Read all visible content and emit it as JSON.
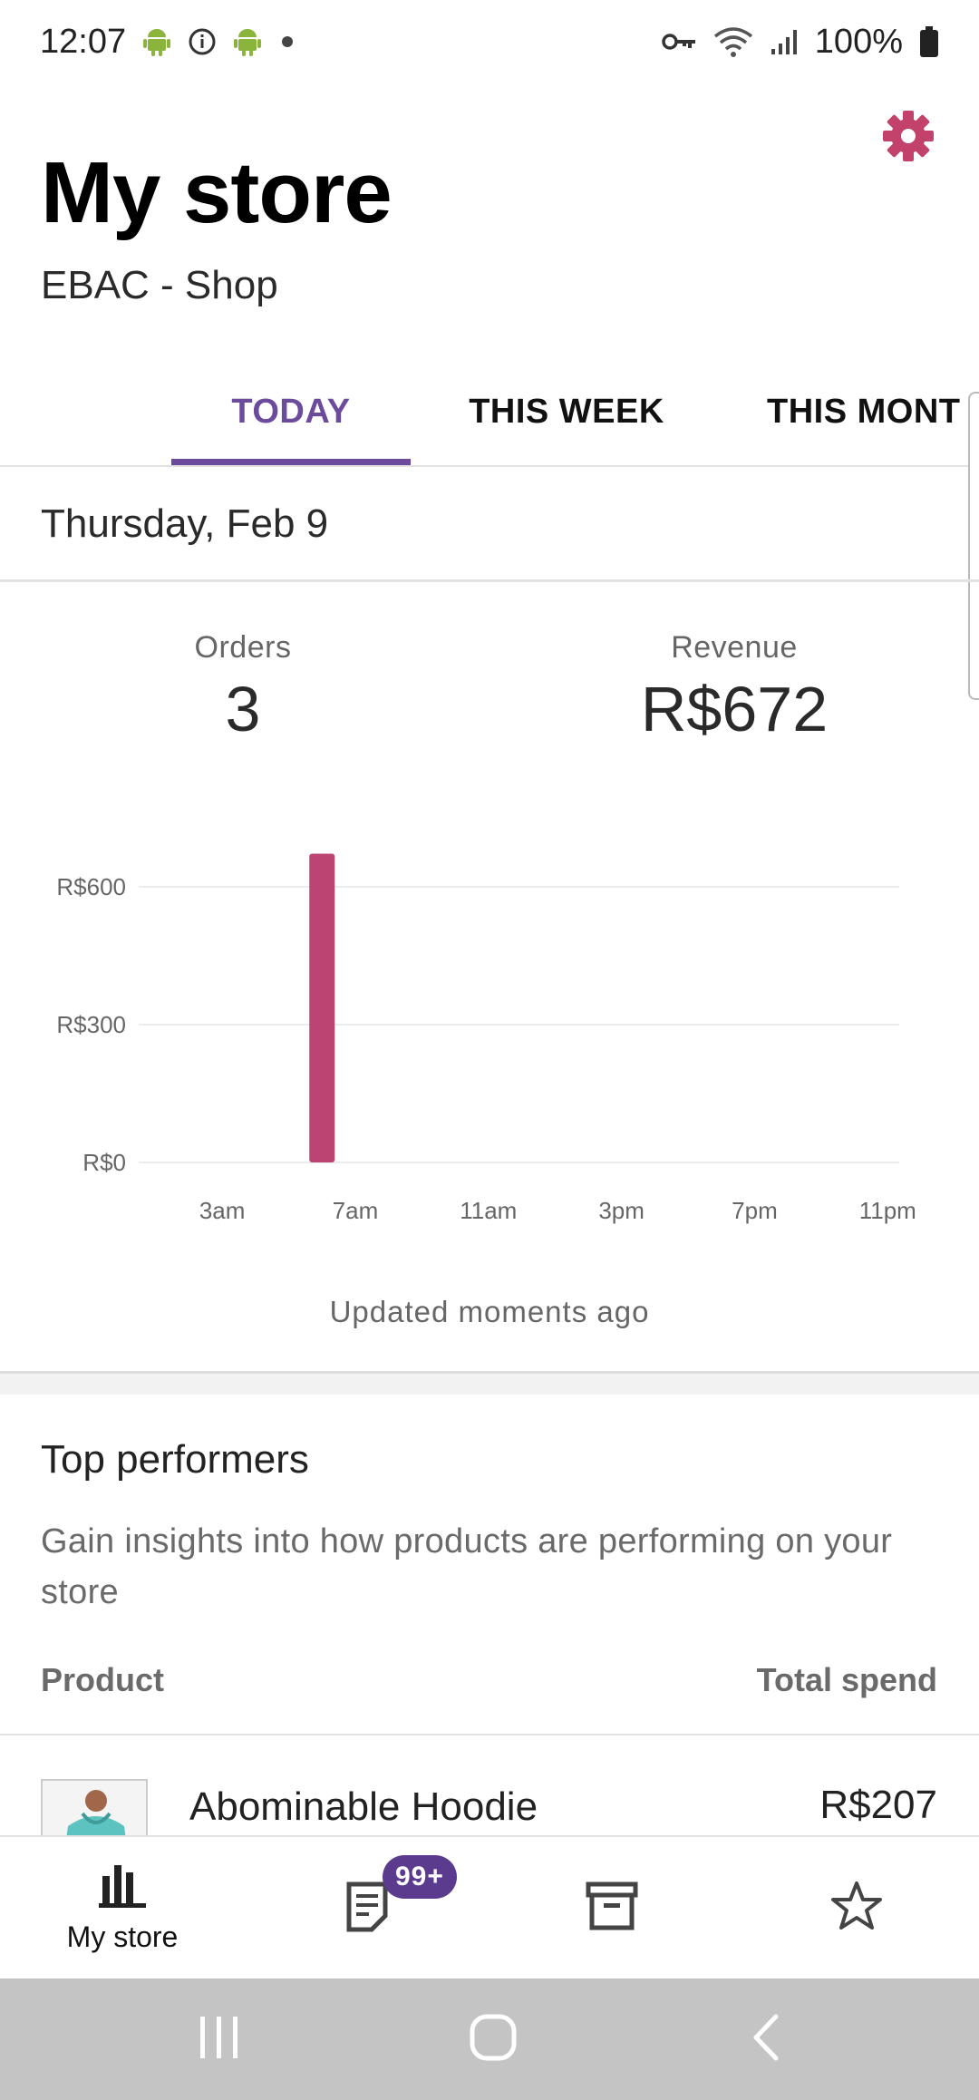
{
  "status_bar": {
    "time": "12:07",
    "battery": "100%",
    "left_icons": [
      "android-icon",
      "info-icon",
      "android-icon",
      "dot-icon"
    ],
    "right_icons": [
      "vpn-key-icon",
      "wifi-icon",
      "signal-icon",
      "battery-icon"
    ]
  },
  "header": {
    "title": "My store",
    "store_name": "EBAC - Shop",
    "settings_icon": "gear-icon",
    "accent_color": "#c2426c"
  },
  "tabs": [
    {
      "label": "TODAY",
      "active": true
    },
    {
      "label": "THIS WEEK",
      "active": false
    },
    {
      "label": "THIS MONT",
      "active": false
    }
  ],
  "date": "Thursday, Feb 9",
  "stats": {
    "orders_label": "Orders",
    "orders_value": "3",
    "revenue_label": "Revenue",
    "revenue_value": "R$672"
  },
  "chart_data": {
    "type": "bar",
    "title": "",
    "xlabel": "",
    "ylabel": "",
    "y_ticks": [
      "R$0",
      "R$300",
      "R$600"
    ],
    "y_tick_values": [
      0,
      300,
      600
    ],
    "x_ticks": [
      "3am",
      "7am",
      "11am",
      "3pm",
      "7pm",
      "11pm"
    ],
    "x_tick_hours": [
      3,
      7,
      11,
      15,
      19,
      23
    ],
    "x_range_hours": [
      0,
      24
    ],
    "ylim": [
      0,
      672
    ],
    "grid": true,
    "bar_color": "#bb4473",
    "bars": [
      {
        "hour": 6,
        "value": 672
      }
    ]
  },
  "updated_text": "Updated moments ago",
  "top_performers": {
    "title": "Top performers",
    "description": "Gain insights into how products are performing on your store",
    "col_product": "Product",
    "col_spend": "Total spend",
    "rows": [
      {
        "name": "Abominable Hoodie",
        "spend": "R$207"
      }
    ]
  },
  "bottom_nav": {
    "items": [
      {
        "icon": "bar-chart-icon",
        "label": "My store"
      },
      {
        "icon": "orders-icon",
        "badge": "99+"
      },
      {
        "icon": "archive-box-icon"
      },
      {
        "icon": "star-icon"
      }
    ]
  },
  "system_nav": [
    "recents-icon",
    "home-icon",
    "back-icon"
  ]
}
